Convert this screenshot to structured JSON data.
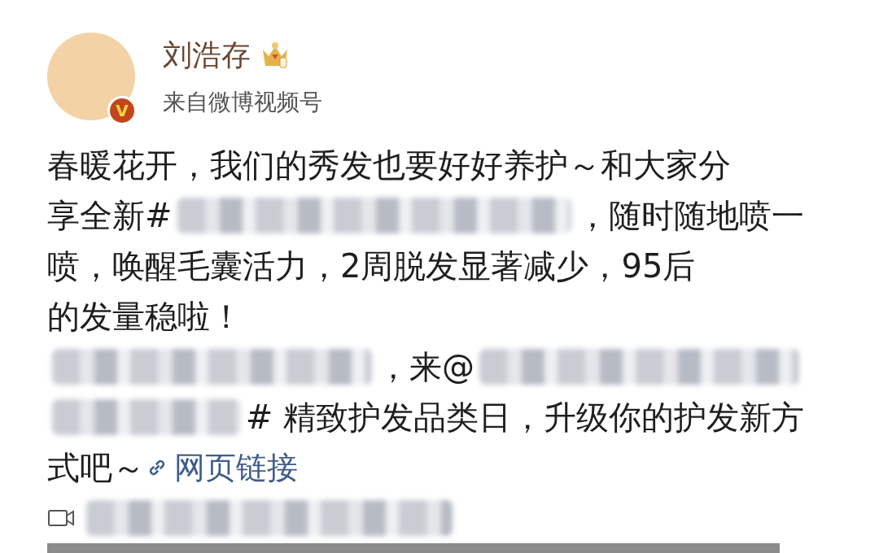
{
  "post": {
    "author": {
      "name": "刘浩存",
      "source": "来自微博视频号",
      "verified": true,
      "badge": "V"
    },
    "lines": [
      {
        "segments": [
          {
            "kind": "text",
            "text": "春暖花开，我们的秀发也要好好养护～和大家分"
          }
        ]
      },
      {
        "segments": [
          {
            "kind": "text",
            "text": "享全新#"
          },
          {
            "kind": "blur"
          },
          {
            "kind": "text",
            "text": "，随时随地喷一"
          }
        ]
      },
      {
        "segments": [
          {
            "kind": "text",
            "text": "喷，唤醒毛囊活力，2周脱发显著减少，95后"
          }
        ]
      },
      {
        "segments": [
          {
            "kind": "text",
            "text": "的发量稳啦！"
          }
        ]
      },
      {
        "segments": [
          {
            "kind": "blur"
          },
          {
            "kind": "text",
            "text": "，来@"
          },
          {
            "kind": "blur"
          }
        ]
      },
      {
        "segments": [
          {
            "kind": "blur"
          },
          {
            "kind": "text",
            "text": "# 精致护发品类日，升级你的护发新方"
          }
        ]
      },
      {
        "segments": [
          {
            "kind": "text",
            "text": "式吧～"
          },
          {
            "kind": "link",
            "text": "网页链接"
          }
        ]
      }
    ],
    "video": {
      "blurred": true
    }
  }
}
